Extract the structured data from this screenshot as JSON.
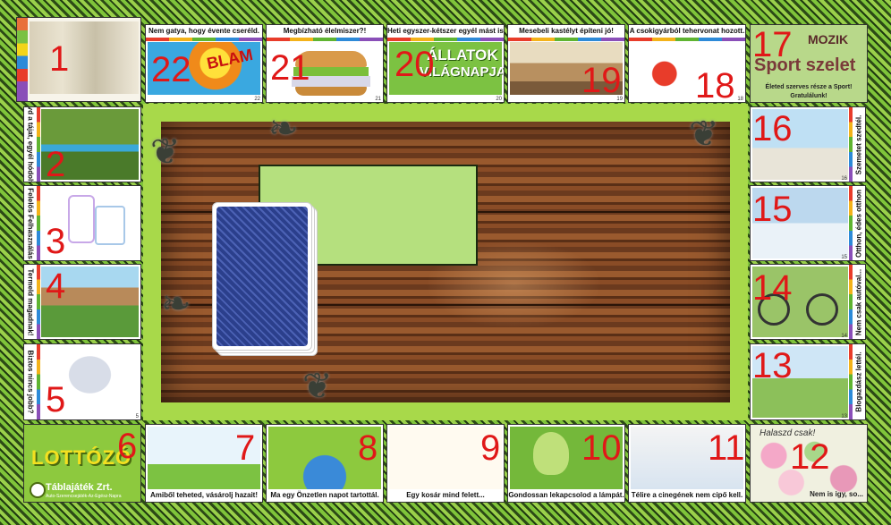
{
  "tiles": {
    "t1": {
      "num": "1"
    },
    "t2": {
      "num": "2",
      "caption": "Óvd a tájat, egyél hódolt..."
    },
    "t3": {
      "num": "3",
      "caption": "Felelős Felhasználás"
    },
    "t4": {
      "num": "4",
      "caption": "Termeld magadnak!"
    },
    "t5": {
      "num": "5",
      "caption": "Biztos nincs jobb?",
      "small": "5"
    },
    "t6": {
      "num": "6",
      "logo": "LOTTÓZÓ",
      "company": "Táblajáték Zrt.",
      "slogan": "Auto-Szerencsejáték-Az-Egész-Napra"
    },
    "t7": {
      "num": "7",
      "caption": "Amiből teheted, vásárolj hazait!",
      "small": "7"
    },
    "t8": {
      "num": "8",
      "caption": "Ma egy Önzetlen napot tartottál.",
      "small": "8"
    },
    "t9": {
      "num": "9",
      "caption": "Egy kosár mind felett...",
      "small": "9"
    },
    "t10": {
      "num": "10",
      "caption": "Gondossan lekapcsolod a lámpát.",
      "small": "10"
    },
    "t11": {
      "num": "11",
      "caption": "Télire a cinegének nem cipő kell.",
      "small": "11"
    },
    "t12": {
      "num": "12",
      "top": "Halaszd csak!",
      "bottom": "Nem is igy, so..."
    },
    "t13": {
      "num": "13",
      "caption": "Blogazdász lettél.",
      "small": "13"
    },
    "t14": {
      "num": "14",
      "caption": "Nem csak autóval...",
      "small": "14"
    },
    "t15": {
      "num": "15",
      "caption": "Otthon, édes otthon",
      "small": "15"
    },
    "t16": {
      "num": "16",
      "caption": "Szemetet szedtél.",
      "small": "16"
    },
    "t17": {
      "num": "17",
      "title1": "MOZIK",
      "title2": "Sport szelet",
      "caption": "Életed szerves része a Sport!",
      "caption2": "Gratulálunk!"
    },
    "t18": {
      "num": "18",
      "caption": "A csokigyárból tehervonat hozott.",
      "small": "18"
    },
    "t19": {
      "num": "19",
      "caption": "Mesebeli kastélyt építeni jó!",
      "small": "19"
    },
    "t20": {
      "num": "20",
      "caption": "Heti egyszer-kétszer egyél mást is!",
      "small": "20",
      "picText1": "ÁLLATOK",
      "picText2": "VILÁGNAPJA"
    },
    "t21": {
      "num": "21",
      "caption": "Megbízható élelmiszer?!",
      "small": "21"
    },
    "t22": {
      "num": "22",
      "caption": "Nem gatya, hogy évente cseréld.",
      "small": "22",
      "picText": "BLAM"
    }
  },
  "colors": {
    "red_number": "#e01818",
    "frame_green": "#a8d94a",
    "card_blue": "#2b3f8c",
    "slot_green": "#b5e07e"
  },
  "icons": [
    "vine-ornament-icon",
    "card-back-icon"
  ]
}
